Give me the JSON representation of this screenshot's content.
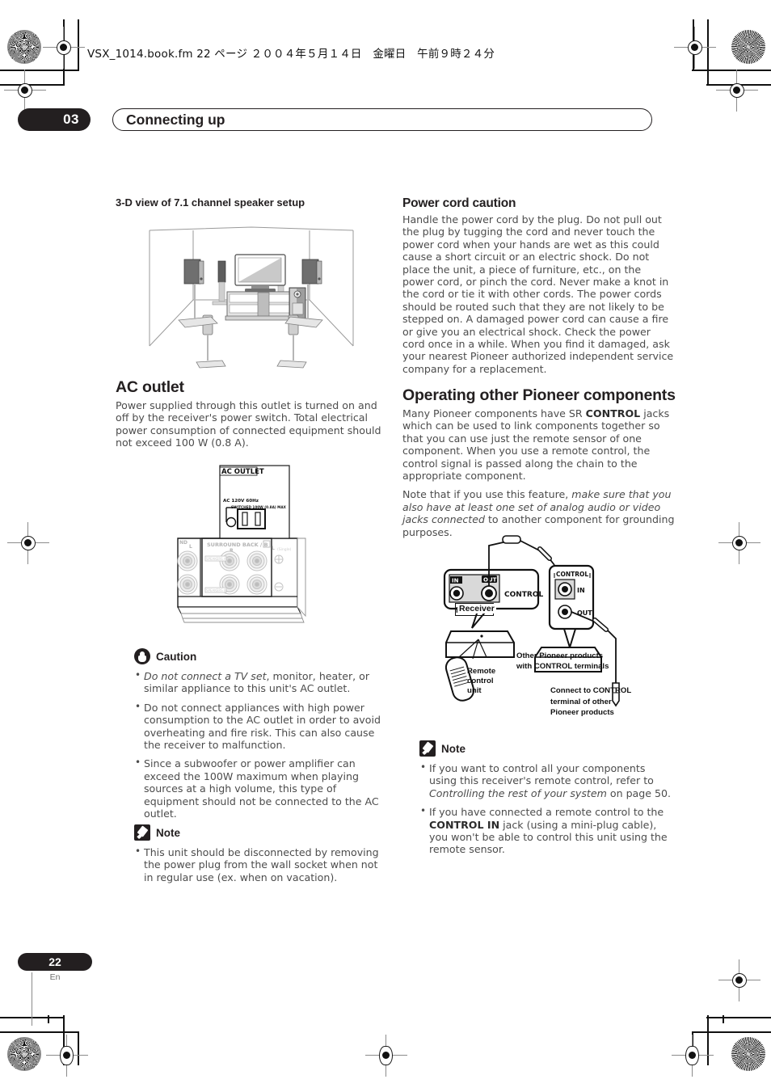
{
  "print": {
    "filename_strip": "VSX_1014.book.fm  22 ページ  ２００４年５月１４日　金曜日　午前９時２４分"
  },
  "header": {
    "chapter_number": "03",
    "chapter_title": "Connecting up"
  },
  "footer": {
    "page_number": "22",
    "language_code": "En"
  },
  "left_column": {
    "figure_caption": "3-D view of 7.1 channel speaker setup",
    "ac_outlet": {
      "heading": "AC outlet",
      "body": "Power supplied through this outlet is turned on and off by the receiver's power switch. Total electrical power consumption of connected equipment should not exceed 100 W (0.8 A)."
    },
    "ac_panel_labels": {
      "outlet_title": "AC OUTLET",
      "voltage": "AC 120V 60Hz",
      "switched": "SWITCHED 100W (0.8A) MAX",
      "surround_back": "SURROUND BACK / B",
      "terminal_r": "R",
      "terminal_l": "L",
      "terminal_single": "(Single)",
      "terminal_nd": "ND",
      "speakers_a": "SPEAKERS A",
      "speakers_b": "SPEAKERS B",
      "plus": "+",
      "minus": "−"
    },
    "caution": {
      "label": "Caution",
      "items": [
        {
          "italic_lead": "Do not connect a TV set",
          "rest": ", monitor, heater, or similar appliance to this unit's AC outlet."
        },
        {
          "italic_lead": "",
          "rest": "Do not connect appliances with high power consumption to the AC outlet in order to avoid overheating and fire risk. This can also cause the receiver to malfunction."
        },
        {
          "italic_lead": "",
          "rest": "Since a subwoofer or power amplifier can exceed the 100W maximum when playing sources at a high volume, this type of equipment should not be connected to the AC outlet."
        }
      ]
    },
    "note": {
      "label": "Note",
      "items": [
        "This unit should be disconnected by removing the power plug from the wall socket when not in regular use (ex. when on vacation)."
      ]
    }
  },
  "right_column": {
    "power_cord": {
      "heading": "Power cord caution",
      "body": "Handle the power cord by the plug. Do not pull out the plug by tugging the cord and never touch the power cord when your hands are wet as this could cause a short circuit or an electric shock. Do not place the unit, a piece of furniture, etc., on the power cord, or pinch the cord. Never make a knot in the cord or tie it with other cords. The power cords should be routed such that they are not likely to be stepped on. A damaged power cord can cause a fire or give you an electrical shock. Check the power cord once in a while. When you find it damaged, ask your nearest Pioneer authorized independent service company for a replacement."
    },
    "operating": {
      "heading": "Operating other Pioneer components",
      "para1_before": "Many Pioneer components have SR ",
      "para1_bold": "CONTROL",
      "para1_after": " jacks which can be used to link components together so that you can use just the remote sensor of one component. When you use a remote control, the control signal is passed along the chain to the appropriate component.",
      "para2_before": "Note that if you use this feature, ",
      "para2_italic": "make sure that you also have at least one set of analog audio or video jacks connected",
      "para2_after": " to another component for grounding purposes."
    },
    "control_figure_labels": {
      "in": "IN",
      "out": "OUT",
      "control": "CONTROL",
      "control_group": "CONTROL",
      "jack_in": "IN",
      "jack_out": "OUT",
      "receiver": "Receiver",
      "remote_control_unit": "Remote\ncontrol\nunit",
      "remote_line1": "Remote",
      "remote_line2": "control",
      "remote_line3": "unit",
      "other_products_line1": "Other Pioneer products",
      "other_products_line2": "with CONTROL terminals",
      "connect_line1": "Connect to CONTROL",
      "connect_line2": "terminal of other",
      "connect_line3": "Pioneer products"
    },
    "note": {
      "label": "Note",
      "items": [
        {
          "before": "If you want to control all your components using this receiver's remote control, refer to ",
          "italic": "Controlling the rest of your system",
          "after": " on page 50."
        },
        {
          "before": "If you have connected a remote control to the ",
          "bold": "CONTROL IN",
          "after": " jack (using a mini-plug cable), you won't be able to control this unit using the remote sensor."
        }
      ]
    }
  },
  "colors": {
    "ink": "#231f20",
    "body_text": "#4c4c4c",
    "diagram_gray": "#9a9a9a",
    "regmark_gray": "#8b8b8b"
  }
}
